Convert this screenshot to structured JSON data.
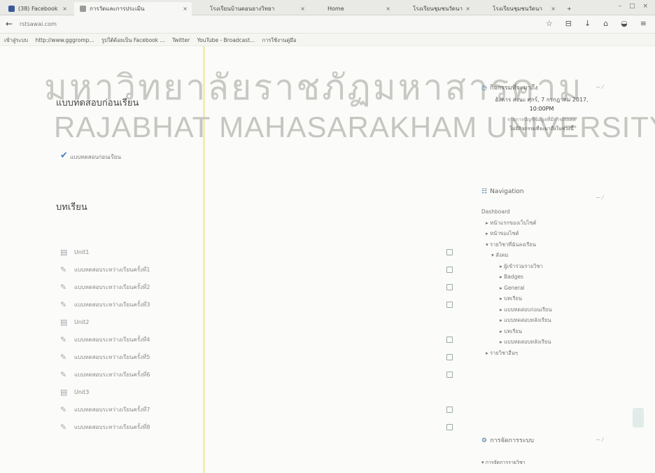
{
  "tabs": [
    {
      "label": "(38) Facebook"
    },
    {
      "label": "การวัดและการประเมิน"
    },
    {
      "label": "โรงเรียนบ้านดอนยางวิทยา"
    },
    {
      "label": "Home"
    },
    {
      "label": "โรงเรียนชุมชนวัดนา"
    },
    {
      "label": "โรงเรียนชุมชนวัดนา"
    }
  ],
  "window_controls": "– □ ×",
  "address": {
    "url": "rstsawai.com"
  },
  "bookmarks": [
    {
      "label": "เข้าสู่ระบบ"
    },
    {
      "label": "http://www.gggromp..."
    },
    {
      "label": "รูปใต้ด้อยเป็น Facebook ..."
    },
    {
      "label": "Twitter"
    },
    {
      "label": "YouTube - Broadcast..."
    },
    {
      "label": "การใช้งานคู่มือ"
    }
  ],
  "watermark": {
    "line1": "มหาวิทยาลัยราชภัฏมหาสารคาม",
    "line2": "RAJABHAT MAHASARAKHAM UNIVERSITY"
  },
  "main": {
    "pretest_heading": "แบบทดสอบก่อนเรียน",
    "pretest_link": "แบบทดสอบก่อนเรียน",
    "lessons_heading": "บทเรียน",
    "lessons": [
      {
        "kind": "unit",
        "label": "Unit1"
      },
      {
        "kind": "quiz",
        "label": "แบบทดสอบระหว่างเรียนครั้งที่1"
      },
      {
        "kind": "quiz",
        "label": "แบบทดสอบระหว่างเรียนครั้งที่2"
      },
      {
        "kind": "quiz",
        "label": "แบบทดสอบระหว่างเรียนครั้งที่3"
      },
      {
        "kind": "unit",
        "label": "Unit2"
      },
      {
        "kind": "quiz",
        "label": "แบบทดสอบระหว่างเรียนครั้งที่4"
      },
      {
        "kind": "quiz",
        "label": "แบบทดสอบระหว่างเรียนครั้งที่5"
      },
      {
        "kind": "quiz",
        "label": "แบบทดสอบระหว่างเรียนครั้งที่6"
      },
      {
        "kind": "unit",
        "label": "Unit3"
      },
      {
        "kind": "quiz",
        "label": "แบบทดสอบระหว่างเรียนครั้งที่7"
      },
      {
        "kind": "quiz",
        "label": "แบบทดสอบระหว่างเรียนครั้งที่8"
      }
    ]
  },
  "calendar_block": {
    "title": "กิจกรรมที่จะมาถึง",
    "date_line": "อังคาร ส่งนะ ศุกร์, 7 กรกฎาคม 2017,",
    "time": "10:00PM",
    "note1": "รายการบัญชีข้อมูลที่มีการอัปเดต",
    "note2": "ไม่มีกิจกรรมที่จะมาถึงในช่วงนี้"
  },
  "navigation_block": {
    "title": "Navigation",
    "items": [
      {
        "level": 1,
        "label": "Dashboard"
      },
      {
        "level": 2,
        "label": "▸ หน้าแรกของเว็บไซต์"
      },
      {
        "level": 2,
        "label": "▸ หน้าของไซต์"
      },
      {
        "level": 2,
        "label": "▾ รายวิชาที่ฉันลงเรียน"
      },
      {
        "level": 3,
        "label": "▾ สังคม"
      },
      {
        "level": 4,
        "label": "▸ ผู้เข้าร่วมรายวิชา"
      },
      {
        "level": 4,
        "label": "▸ Badges"
      },
      {
        "level": 4,
        "label": "▸ General"
      },
      {
        "level": 4,
        "label": "▸ บทเรียน"
      },
      {
        "level": 4,
        "label": "▸ แบบทดสอบก่อนเรียน"
      },
      {
        "level": 4,
        "label": "▸ แบบทดสอบหลังเรียน"
      },
      {
        "level": 4,
        "label": "▸ บทเรียน"
      },
      {
        "level": 4,
        "label": "▸ แบบทดสอบหลังเรียน"
      },
      {
        "level": 2,
        "label": "▸ รายวิชาอื่นๆ"
      }
    ]
  },
  "admin_block": {
    "title": "การจัดการระบบ",
    "sub": "▾ การจัดการรายวิชา"
  },
  "colors": {
    "link": "#4a7fbf",
    "watermark": "#c6c6c1",
    "highlight": "#f2e9a8"
  }
}
